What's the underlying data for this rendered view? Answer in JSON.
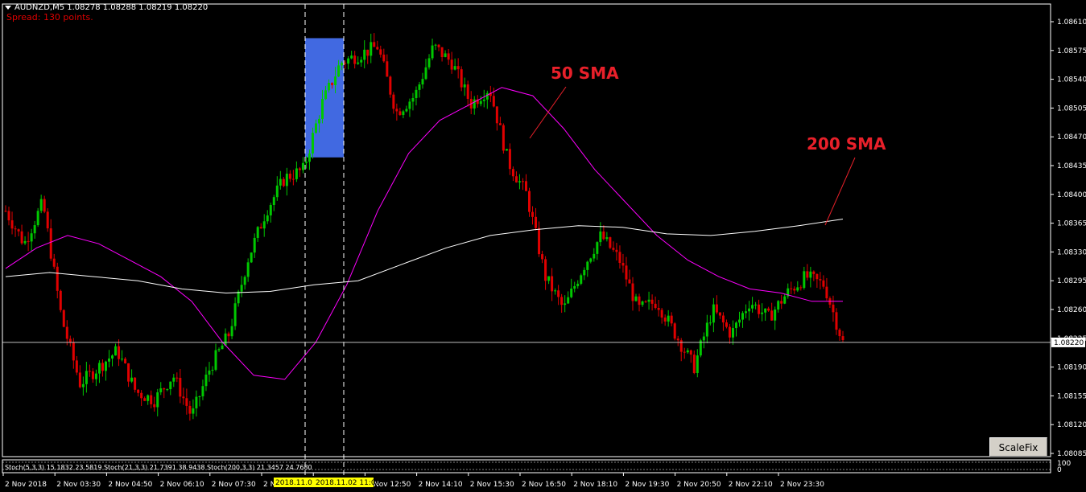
{
  "header": {
    "symbol_line": "AUDNZD,M5  1.08278 1.08288 1.08219 1.08220",
    "spread": "Spread: 130 points."
  },
  "toolbar": {
    "scalefix_label": "ScaleFix"
  },
  "indicator": {
    "stoch_text": "Stoch(5,3,3) 15.1832 23.5819  Stoch(21,3,3) 21.7391 38.9438  Stoch(200,3,3) 21.3457 24.7680",
    "scale_top": "100",
    "scale_bottom": "0"
  },
  "chart_data": {
    "type": "candlestick",
    "symbol": "AUDNZD",
    "timeframe": "M5",
    "y_ticks": [
      "1.08610",
      "1.08575",
      "1.08540",
      "1.08505",
      "1.08470",
      "1.08435",
      "1.08400",
      "1.08365",
      "1.08330",
      "1.08295",
      "1.08260",
      "1.08225",
      "1.08190",
      "1.08155",
      "1.08120",
      "1.08085"
    ],
    "ylim": [
      1.0808,
      1.0863
    ],
    "current_price_label": "1.08220",
    "x_ticks": [
      "2 Nov 2018",
      "2 Nov 03:30",
      "2 Nov 04:50",
      "2 Nov 06:10",
      "2 Nov 07:30",
      "2 Nov 08:50",
      "2 Nov 11:30",
      "2 Nov 12:50",
      "2 Nov 14:10",
      "2 Nov 15:30",
      "2 Nov 16:50",
      "2 Nov 18:10",
      "2 Nov 19:30",
      "2 Nov 20:50",
      "2 Nov 22:10",
      "2 Nov 23:30"
    ],
    "x_highlight_labels": [
      "2018.11.0",
      "2018.11.02 11:00"
    ],
    "annotations": [
      {
        "text": "50 SMA",
        "points_to": "50 SMA"
      },
      {
        "text": "200 SMA",
        "points_to": "200 SMA"
      }
    ],
    "series": [
      {
        "name": "50 SMA",
        "color": "#ff00ff",
        "values": [
          1.0831,
          1.08335,
          1.0835,
          1.0834,
          1.0832,
          1.083,
          1.0827,
          1.0822,
          1.0818,
          1.08175,
          1.0822,
          1.0829,
          1.0838,
          1.0845,
          1.0849,
          1.0851,
          1.0853,
          1.0852,
          1.0848,
          1.0843,
          1.0839,
          1.0835,
          1.0832,
          1.083,
          1.08285,
          1.0828,
          1.0827,
          1.0827
        ]
      },
      {
        "name": "200 SMA",
        "color": "#ffffff",
        "values": [
          1.083,
          1.08305,
          1.083,
          1.08295,
          1.08285,
          1.0828,
          1.08282,
          1.0829,
          1.08295,
          1.08315,
          1.08335,
          1.0835,
          1.08357,
          1.08362,
          1.0836,
          1.08352,
          1.0835,
          1.08355,
          1.08362,
          1.0837
        ]
      }
    ],
    "close_path": [
      1.0838,
      1.0834,
      1.0839,
      1.0825,
      1.0817,
      1.0819,
      1.0821,
      1.0816,
      1.0815,
      1.0818,
      1.0813,
      1.0819,
      1.0823,
      1.0832,
      1.0838,
      1.0842,
      1.0843,
      1.0851,
      1.0856,
      1.0857,
      1.0858,
      1.085,
      1.0852,
      1.0858,
      1.0856,
      1.0851,
      1.0853,
      1.0844,
      1.084,
      1.083,
      1.0826,
      1.0831,
      1.0835,
      1.0832,
      1.0826,
      1.0827,
      1.0823,
      1.0819,
      1.0826,
      1.0823,
      1.0827,
      1.0825,
      1.0828,
      1.083,
      1.0829,
      1.0822
    ],
    "highlight_box": {
      "from_time": "2 Nov 08:50",
      "to_time": "2018.11.02 11:00",
      "high": 1.0859,
      "low": 1.08445,
      "color": "#4169e1"
    }
  }
}
